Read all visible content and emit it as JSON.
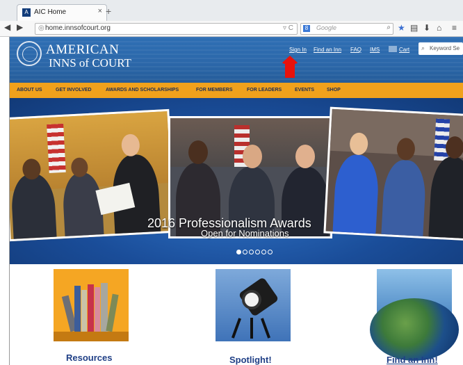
{
  "browser": {
    "tab_title": "AIC Home",
    "tab_close": "×",
    "new_tab": "+",
    "url": "home.innsofcourt.org",
    "url_suffix": "▿ C",
    "search_engine_label": "8",
    "search_placeholder": "Google"
  },
  "site": {
    "logo_line1": "AMERICAN",
    "logo_line2": "INNS of COURT",
    "header_links": [
      "Sign In",
      "Find an Inn",
      "FAQ",
      "IMS",
      "Cart"
    ],
    "search_placeholder": "Keyword Se",
    "menu": [
      "ABOUT US",
      "GET INVOLVED",
      "AWARDS AND SCHOLARSHIPS",
      "FOR MEMBERS",
      "FOR LEADERS",
      "EVENTS",
      "SHOP"
    ],
    "hero": {
      "title": "2016 Professionalism Awards",
      "subtitle": "Open for Nominations",
      "slide_count": 6,
      "active_slide": 1
    },
    "tiles": [
      {
        "label": "Resources"
      },
      {
        "label": "Spotlight!"
      },
      {
        "label": "Find an Inn!"
      }
    ]
  },
  "colors": {
    "header_blue": "#2b67a9",
    "menu_orange": "#f0a11c",
    "menu_text": "#1f2e54",
    "tile_label": "#1f3f86",
    "arrow_red": "#e8120c"
  },
  "icons": [
    "back-icon",
    "forward-icon",
    "globe-icon",
    "reload-icon",
    "search-icon",
    "star-icon",
    "clipboard-icon",
    "download-icon",
    "home-icon",
    "menu-icon",
    "cart-icon",
    "seal-logo-icon"
  ]
}
